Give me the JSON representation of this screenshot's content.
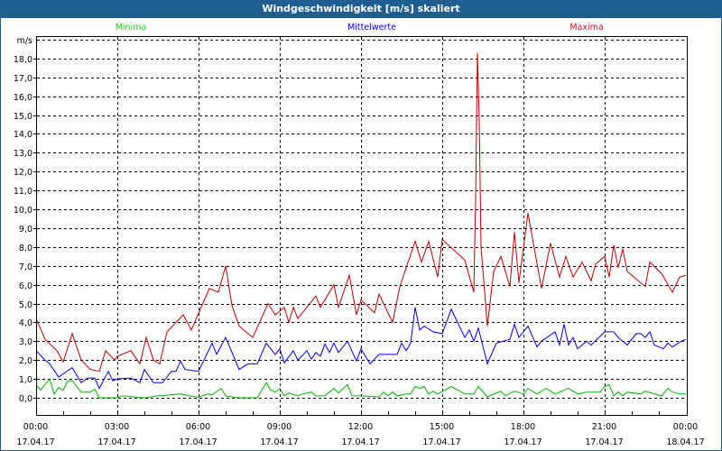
{
  "title": "Windgeschwindigkeit [m/s] skaliert",
  "chart_data": {
    "type": "line",
    "title": "Windgeschwindigkeit [m/s] skaliert",
    "ylabel": "m/s",
    "xlabel": "",
    "ylim": [
      0,
      19
    ],
    "xlim_minutes": [
      0,
      1440
    ],
    "grid": true,
    "yticks": [
      "0,0",
      "1,0",
      "2,0",
      "3,0",
      "4,0",
      "5,0",
      "6,0",
      "7,0",
      "8,0",
      "9,0",
      "10,0",
      "11,0",
      "12,0",
      "13,0",
      "14,0",
      "15,0",
      "16,0",
      "17,0",
      "18,0"
    ],
    "xticks": [
      {
        "time": "00:00",
        "date": "17.04.17"
      },
      {
        "time": "03:00",
        "date": "17.04.17"
      },
      {
        "time": "06:00",
        "date": "17.04.17"
      },
      {
        "time": "09:00",
        "date": "17.04.17"
      },
      {
        "time": "12:00",
        "date": "17.04.17"
      },
      {
        "time": "15:00",
        "date": "17.04.17"
      },
      {
        "time": "18:00",
        "date": "17.04.17"
      },
      {
        "time": "21:00",
        "date": "17.04.17"
      },
      {
        "time": "00:00",
        "date": "18.04.17"
      }
    ],
    "legend_placement": "top",
    "series": [
      {
        "name": "Minima",
        "color": "#00b400",
        "legend_color": "#22cc22",
        "points": [
          [
            0,
            0.7
          ],
          [
            10,
            0.4
          ],
          [
            30,
            1.0
          ],
          [
            40,
            0.2
          ],
          [
            50,
            0.55
          ],
          [
            60,
            0.4
          ],
          [
            70,
            0.9
          ],
          [
            80,
            0.9
          ],
          [
            100,
            0.3
          ],
          [
            120,
            0.3
          ],
          [
            130,
            0.45
          ],
          [
            140,
            0
          ],
          [
            180,
            0
          ],
          [
            190,
            0.1
          ],
          [
            240,
            0
          ],
          [
            270,
            0.1
          ],
          [
            320,
            0.2
          ],
          [
            340,
            0.1
          ],
          [
            360,
            0.03
          ],
          [
            380,
            0.2
          ],
          [
            390,
            0.15
          ],
          [
            410,
            0.5
          ],
          [
            420,
            0.1
          ],
          [
            450,
            0
          ],
          [
            490,
            0
          ],
          [
            510,
            0.8
          ],
          [
            520,
            0.4
          ],
          [
            530,
            0.3
          ],
          [
            540,
            0.5
          ],
          [
            550,
            0.1
          ],
          [
            560,
            0.25
          ],
          [
            580,
            0.1
          ],
          [
            590,
            0.2
          ],
          [
            610,
            0.3
          ],
          [
            620,
            0.1
          ],
          [
            640,
            0.1
          ],
          [
            660,
            0.5
          ],
          [
            670,
            0.25
          ],
          [
            690,
            0.7
          ],
          [
            700,
            0.1
          ],
          [
            720,
            0.1
          ],
          [
            760,
            0.05
          ],
          [
            770,
            0.3
          ],
          [
            780,
            0.1
          ],
          [
            790,
            0.3
          ],
          [
            800,
            0.1
          ],
          [
            820,
            0.2
          ],
          [
            830,
            0.2
          ],
          [
            840,
            0.6
          ],
          [
            850,
            0.5
          ],
          [
            860,
            0.6
          ],
          [
            870,
            0.2
          ],
          [
            880,
            0.35
          ],
          [
            890,
            0.2
          ],
          [
            920,
            0.6
          ],
          [
            950,
            0.2
          ],
          [
            970,
            0.2
          ],
          [
            980,
            0.6
          ],
          [
            1000,
            0.05
          ],
          [
            1030,
            0.35
          ],
          [
            1040,
            0.1
          ],
          [
            1060,
            0.35
          ],
          [
            1080,
            0.2
          ],
          [
            1090,
            0.5
          ],
          [
            1110,
            0.2
          ],
          [
            1130,
            0.5
          ],
          [
            1150,
            0.2
          ],
          [
            1180,
            0.5
          ],
          [
            1200,
            0.2
          ],
          [
            1220,
            0.3
          ],
          [
            1250,
            0.3
          ],
          [
            1260,
            0.6
          ],
          [
            1270,
            0.7
          ],
          [
            1280,
            0.1
          ],
          [
            1290,
            0.3
          ],
          [
            1300,
            0.1
          ],
          [
            1310,
            0.3
          ],
          [
            1340,
            0.2
          ],
          [
            1350,
            0.35
          ],
          [
            1386,
            0.1
          ],
          [
            1400,
            0.5
          ],
          [
            1410,
            0.3
          ],
          [
            1426,
            0.2
          ],
          [
            1440,
            0.2
          ]
        ]
      },
      {
        "name": "Mittelwerte",
        "color": "#0000ee",
        "legend_color": "#0000ee",
        "points": [
          [
            0,
            2.5
          ],
          [
            20,
            2.0
          ],
          [
            30,
            1.8
          ],
          [
            50,
            1.1
          ],
          [
            80,
            1.6
          ],
          [
            100,
            0.8
          ],
          [
            114,
            1.05
          ],
          [
            130,
            1.05
          ],
          [
            140,
            0.5
          ],
          [
            160,
            1.4
          ],
          [
            170,
            0.9
          ],
          [
            180,
            1.0
          ],
          [
            210,
            1.05
          ],
          [
            230,
            0.8
          ],
          [
            240,
            1.5
          ],
          [
            260,
            0.8
          ],
          [
            280,
            0.8
          ],
          [
            300,
            1.4
          ],
          [
            310,
            1.4
          ],
          [
            320,
            1.95
          ],
          [
            330,
            1.5
          ],
          [
            360,
            1.4
          ],
          [
            390,
            2.9
          ],
          [
            400,
            2.3
          ],
          [
            420,
            3.2
          ],
          [
            450,
            1.5
          ],
          [
            470,
            1.8
          ],
          [
            490,
            1.8
          ],
          [
            510,
            2.9
          ],
          [
            530,
            2.3
          ],
          [
            540,
            2.6
          ],
          [
            550,
            1.85
          ],
          [
            570,
            2.5
          ],
          [
            580,
            2.0
          ],
          [
            600,
            2.5
          ],
          [
            610,
            2.05
          ],
          [
            620,
            2.4
          ],
          [
            630,
            2.2
          ],
          [
            640,
            2.85
          ],
          [
            650,
            2.4
          ],
          [
            660,
            2.9
          ],
          [
            670,
            2.4
          ],
          [
            690,
            3.0
          ],
          [
            710,
            1.95
          ],
          [
            720,
            2.6
          ],
          [
            740,
            1.8
          ],
          [
            760,
            2.3
          ],
          [
            800,
            2.3
          ],
          [
            810,
            2.9
          ],
          [
            820,
            2.5
          ],
          [
            830,
            2.9
          ],
          [
            840,
            4.8
          ],
          [
            850,
            3.6
          ],
          [
            860,
            3.8
          ],
          [
            880,
            3.5
          ],
          [
            900,
            3.4
          ],
          [
            920,
            4.7
          ],
          [
            950,
            3.2
          ],
          [
            960,
            3.6
          ],
          [
            970,
            3.0
          ],
          [
            980,
            3.7
          ],
          [
            1000,
            1.8
          ],
          [
            1020,
            2.9
          ],
          [
            1050,
            3.1
          ],
          [
            1060,
            3.9
          ],
          [
            1070,
            3.2
          ],
          [
            1090,
            3.8
          ],
          [
            1110,
            2.7
          ],
          [
            1120,
            3.0
          ],
          [
            1150,
            3.5
          ],
          [
            1160,
            2.8
          ],
          [
            1170,
            3.9
          ],
          [
            1180,
            2.8
          ],
          [
            1190,
            3.2
          ],
          [
            1200,
            2.6
          ],
          [
            1220,
            3.0
          ],
          [
            1230,
            2.8
          ],
          [
            1260,
            3.5
          ],
          [
            1280,
            3.5
          ],
          [
            1290,
            3.2
          ],
          [
            1310,
            2.8
          ],
          [
            1330,
            3.4
          ],
          [
            1340,
            3.4
          ],
          [
            1350,
            3.2
          ],
          [
            1360,
            3.5
          ],
          [
            1370,
            2.8
          ],
          [
            1390,
            2.6
          ],
          [
            1400,
            2.9
          ],
          [
            1410,
            2.7
          ],
          [
            1430,
            3.0
          ],
          [
            1440,
            3.1
          ]
        ]
      },
      {
        "name": "Maxima",
        "color": "#c00000",
        "legend_color": "#c0102a",
        "points": [
          [
            0,
            4.2
          ],
          [
            20,
            3.1
          ],
          [
            46,
            2.5
          ],
          [
            60,
            1.9
          ],
          [
            80,
            3.4
          ],
          [
            100,
            2.0
          ],
          [
            120,
            1.5
          ],
          [
            140,
            1.4
          ],
          [
            154,
            2.5
          ],
          [
            174,
            2.0
          ],
          [
            180,
            2.2
          ],
          [
            210,
            2.5
          ],
          [
            230,
            1.8
          ],
          [
            244,
            3.2
          ],
          [
            260,
            2.0
          ],
          [
            274,
            1.8
          ],
          [
            290,
            3.5
          ],
          [
            326,
            4.4
          ],
          [
            344,
            3.6
          ],
          [
            384,
            5.8
          ],
          [
            404,
            5.6
          ],
          [
            420,
            7.0
          ],
          [
            434,
            4.9
          ],
          [
            450,
            3.8
          ],
          [
            480,
            3.2
          ],
          [
            514,
            5.0
          ],
          [
            530,
            4.4
          ],
          [
            550,
            4.8
          ],
          [
            560,
            4.0
          ],
          [
            570,
            4.8
          ],
          [
            580,
            4.2
          ],
          [
            620,
            5.4
          ],
          [
            630,
            4.8
          ],
          [
            660,
            6.0
          ],
          [
            670,
            4.8
          ],
          [
            694,
            6.5
          ],
          [
            710,
            4.4
          ],
          [
            720,
            5.2
          ],
          [
            750,
            4.5
          ],
          [
            760,
            5.5
          ],
          [
            790,
            4.0
          ],
          [
            806,
            5.9
          ],
          [
            840,
            8.3
          ],
          [
            854,
            7.2
          ],
          [
            870,
            8.3
          ],
          [
            890,
            6.4
          ],
          [
            900,
            8.4
          ],
          [
            950,
            7.3
          ],
          [
            970,
            5.6
          ],
          [
            974,
            10.6
          ],
          [
            978,
            18.3
          ],
          [
            982,
            14.8
          ],
          [
            986,
            8.0
          ],
          [
            1000,
            3.8
          ],
          [
            1014,
            6.7
          ],
          [
            1030,
            7.5
          ],
          [
            1050,
            5.9
          ],
          [
            1060,
            8.8
          ],
          [
            1070,
            6.1
          ],
          [
            1090,
            9.8
          ],
          [
            1120,
            5.8
          ],
          [
            1140,
            8.2
          ],
          [
            1160,
            6.4
          ],
          [
            1174,
            7.5
          ],
          [
            1190,
            6.4
          ],
          [
            1210,
            7.2
          ],
          [
            1230,
            6.2
          ],
          [
            1240,
            7.1
          ],
          [
            1260,
            7.5
          ],
          [
            1270,
            6.4
          ],
          [
            1280,
            8.1
          ],
          [
            1290,
            6.9
          ],
          [
            1300,
            7.9
          ],
          [
            1310,
            6.7
          ],
          [
            1350,
            5.9
          ],
          [
            1360,
            7.2
          ],
          [
            1386,
            6.6
          ],
          [
            1410,
            5.6
          ],
          [
            1426,
            6.4
          ],
          [
            1440,
            6.5
          ]
        ]
      }
    ]
  }
}
